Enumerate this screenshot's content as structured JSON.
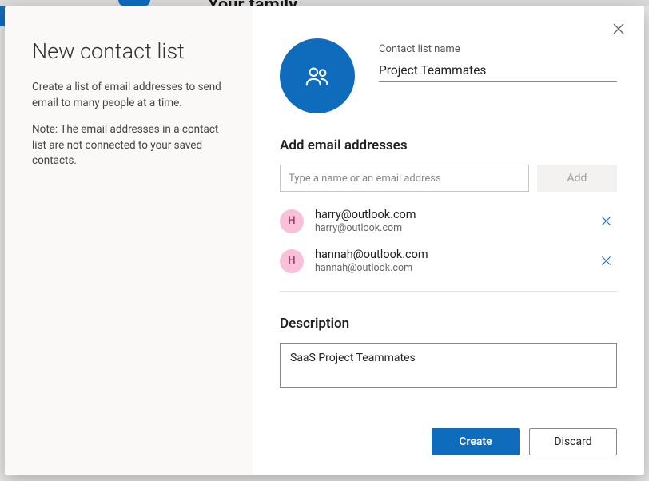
{
  "backdrop": {
    "title": "Your family"
  },
  "leftPane": {
    "heading": "New contact list",
    "intro": "Create a list of email addresses to send email to many people at a time.",
    "note": "Note: The email addresses in a contact list are not connected to your saved contacts."
  },
  "nameField": {
    "label": "Contact list name",
    "value": "Project Teammates"
  },
  "addEmails": {
    "heading": "Add email addresses",
    "placeholder": "Type a name or an email address",
    "addLabel": "Add"
  },
  "members": [
    {
      "initial": "H",
      "primary": "harry@outlook.com",
      "secondary": "harry@outlook.com"
    },
    {
      "initial": "H",
      "primary": "hannah@outlook.com",
      "secondary": "hannah@outlook.com"
    }
  ],
  "description": {
    "heading": "Description",
    "value": "SaaS Project Teammates"
  },
  "footer": {
    "create": "Create",
    "discard": "Discard"
  }
}
